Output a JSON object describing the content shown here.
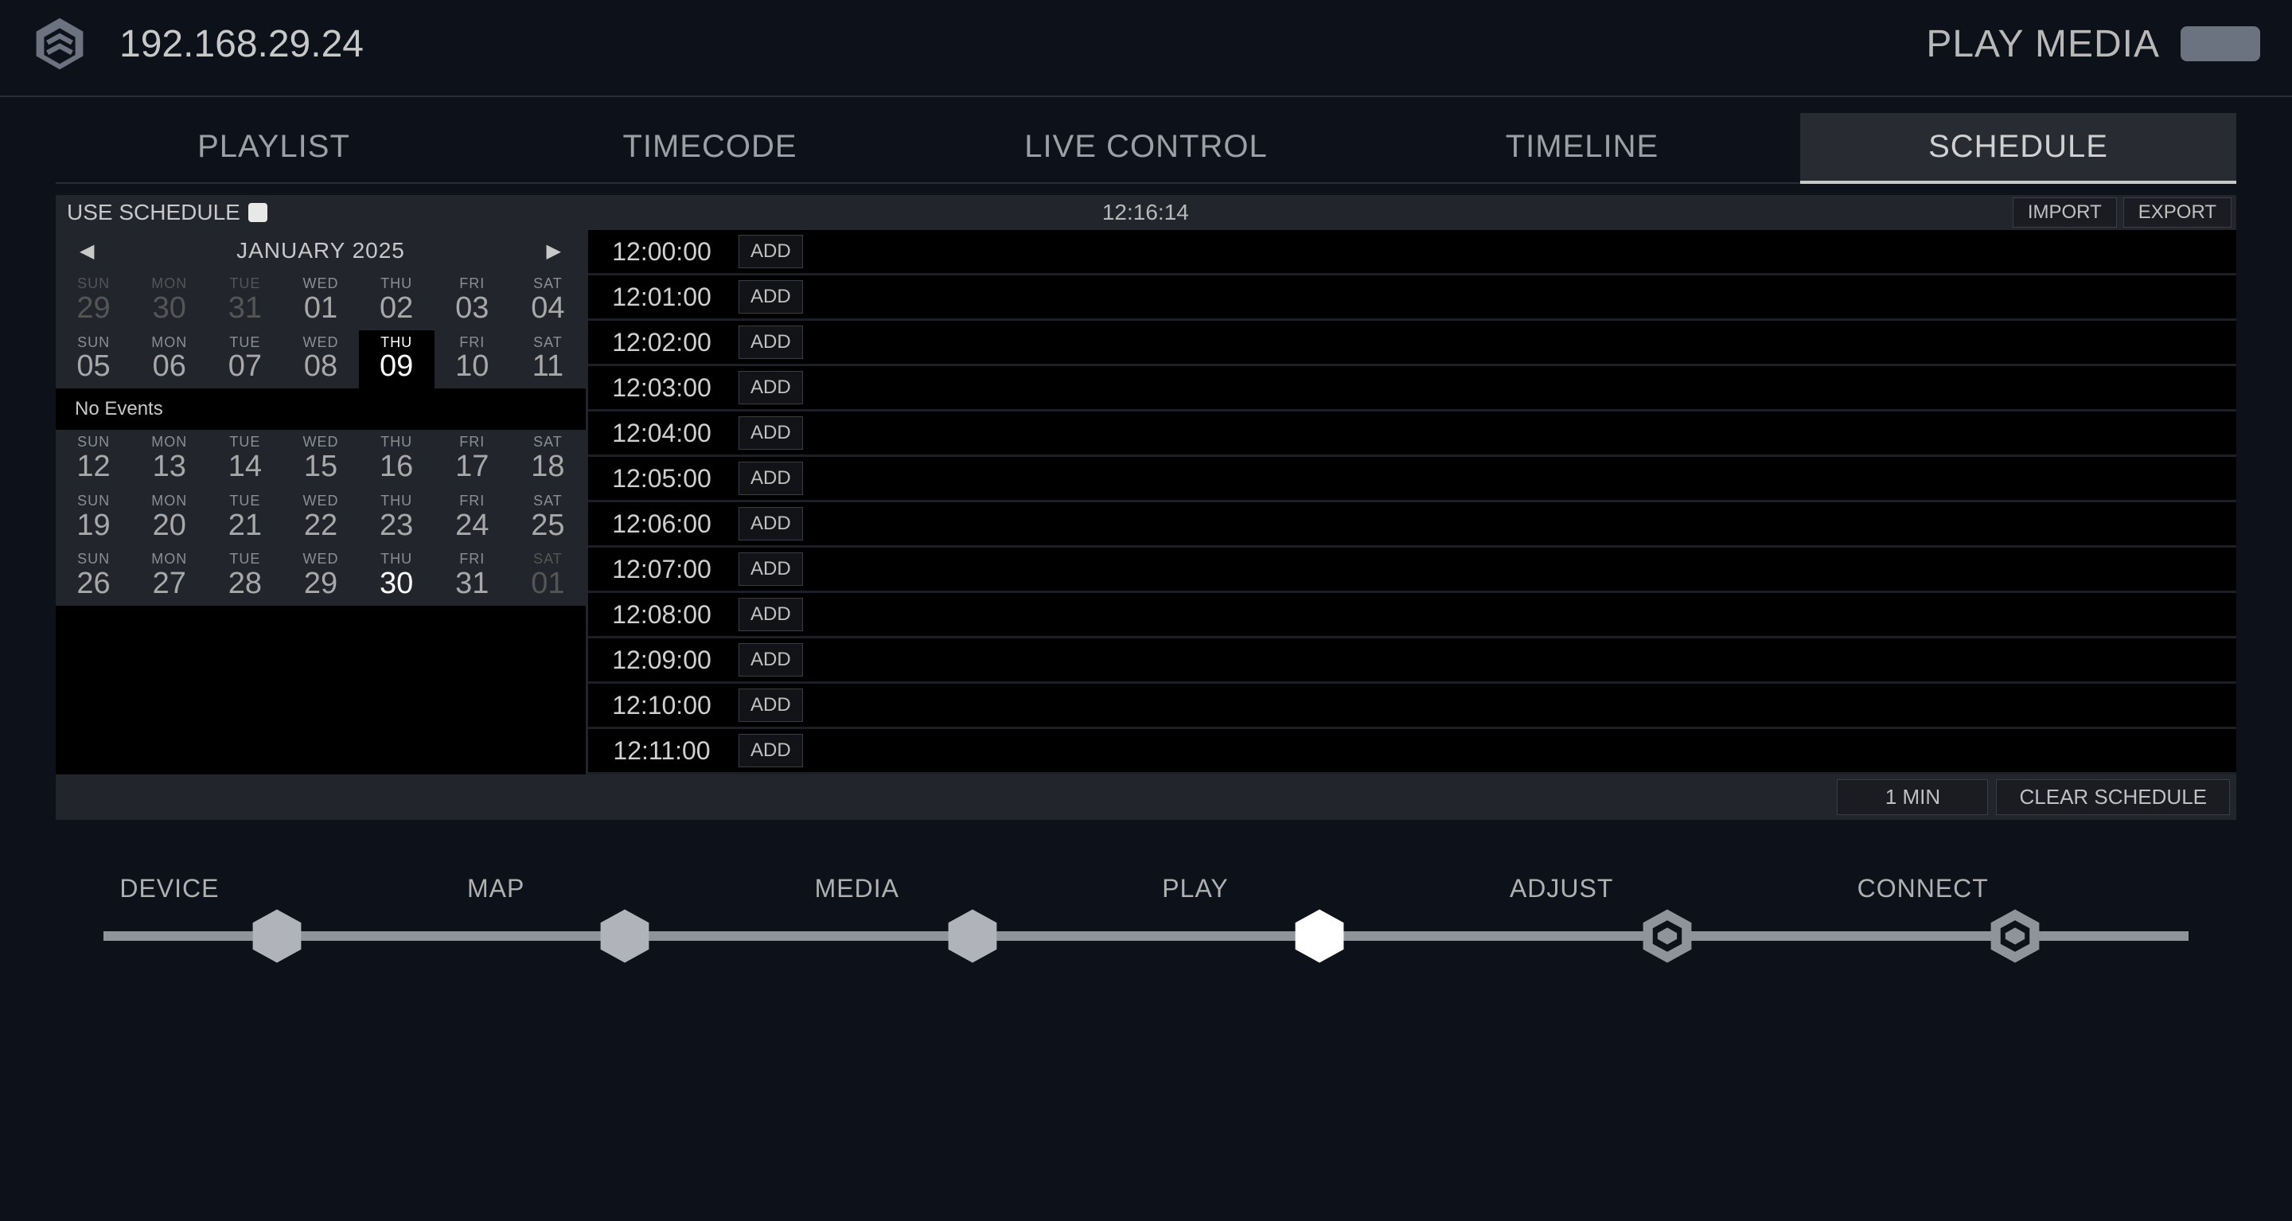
{
  "header": {
    "ip": "192.168.29.24",
    "title": "PLAY MEDIA"
  },
  "tabs": [
    "PLAYLIST",
    "TIMECODE",
    "LIVE CONTROL",
    "TIMELINE",
    "SCHEDULE"
  ],
  "active_tab": "SCHEDULE",
  "topbar": {
    "use_schedule_label": "USE SCHEDULE",
    "use_schedule_checked": false,
    "current_time": "12:16:14",
    "import": "IMPORT",
    "export": "EXPORT"
  },
  "calendar": {
    "month_label": "JANUARY 2025",
    "no_events": "No Events",
    "today": "09",
    "highlight": "30",
    "rows": [
      [
        {
          "dow": "SUN",
          "num": "29",
          "out": true
        },
        {
          "dow": "MON",
          "num": "30",
          "out": true
        },
        {
          "dow": "TUE",
          "num": "31",
          "out": true
        },
        {
          "dow": "WED",
          "num": "01"
        },
        {
          "dow": "THU",
          "num": "02"
        },
        {
          "dow": "FRI",
          "num": "03"
        },
        {
          "dow": "SAT",
          "num": "04"
        }
      ],
      [
        {
          "dow": "SUN",
          "num": "05"
        },
        {
          "dow": "MON",
          "num": "06"
        },
        {
          "dow": "TUE",
          "num": "07"
        },
        {
          "dow": "WED",
          "num": "08"
        },
        {
          "dow": "THU",
          "num": "09"
        },
        {
          "dow": "FRI",
          "num": "10"
        },
        {
          "dow": "SAT",
          "num": "11"
        }
      ],
      [
        {
          "dow": "SUN",
          "num": "12"
        },
        {
          "dow": "MON",
          "num": "13"
        },
        {
          "dow": "TUE",
          "num": "14"
        },
        {
          "dow": "WED",
          "num": "15"
        },
        {
          "dow": "THU",
          "num": "16"
        },
        {
          "dow": "FRI",
          "num": "17"
        },
        {
          "dow": "SAT",
          "num": "18"
        }
      ],
      [
        {
          "dow": "SUN",
          "num": "19"
        },
        {
          "dow": "MON",
          "num": "20"
        },
        {
          "dow": "TUE",
          "num": "21"
        },
        {
          "dow": "WED",
          "num": "22"
        },
        {
          "dow": "THU",
          "num": "23"
        },
        {
          "dow": "FRI",
          "num": "24"
        },
        {
          "dow": "SAT",
          "num": "25"
        }
      ],
      [
        {
          "dow": "SUN",
          "num": "26"
        },
        {
          "dow": "MON",
          "num": "27"
        },
        {
          "dow": "TUE",
          "num": "28"
        },
        {
          "dow": "WED",
          "num": "29"
        },
        {
          "dow": "THU",
          "num": "30"
        },
        {
          "dow": "FRI",
          "num": "31"
        },
        {
          "dow": "SAT",
          "num": "01",
          "out": true
        }
      ]
    ]
  },
  "time_rows": [
    "12:00:00",
    "12:01:00",
    "12:02:00",
    "12:03:00",
    "12:04:00",
    "12:05:00",
    "12:06:00",
    "12:07:00",
    "12:08:00",
    "12:09:00",
    "12:10:00",
    "12:11:00"
  ],
  "add_label": "ADD",
  "bottombar": {
    "interval": "1 MIN",
    "clear": "CLEAR SCHEDULE"
  },
  "stepper": {
    "steps": [
      "DEVICE",
      "MAP",
      "MEDIA",
      "PLAY",
      "ADJUST",
      "CONNECT"
    ],
    "active": "PLAY",
    "completed": [
      "DEVICE",
      "MAP",
      "MEDIA"
    ]
  }
}
